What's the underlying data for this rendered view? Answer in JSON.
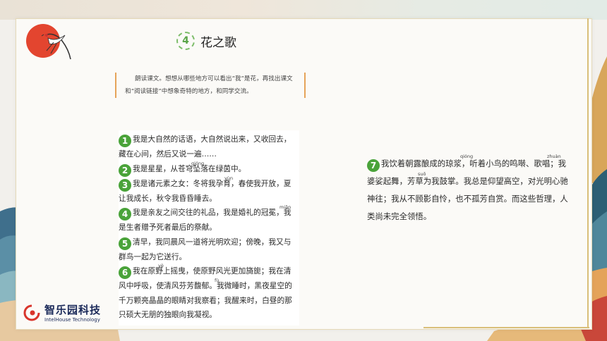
{
  "lesson": {
    "number": "4",
    "title": "花之歌"
  },
  "instruction": "朗读课文。想想从哪些地方可以看出“我”是花，再找出课文和“阅读链接”中想象奇特的地方，和同学交流。",
  "stanzas": [
    {
      "num": "1",
      "text": "我是大自然的话语，大自然说出来，又收回去，藏在心间，然后又说一遍……"
    },
    {
      "num": "2",
      "text": "我是星星，从苍穹坠落在绿茵中。",
      "pinyin": [
        {
          "char": "穹",
          "py": "qióng"
        }
      ]
    },
    {
      "num": "3",
      "text": "我是诸元素之女：冬将我孕育，春使我开放，夏让我成长，秋令我昏昏睡去。",
      "pinyin": [
        {
          "char": "孕",
          "py": "yùn"
        }
      ]
    },
    {
      "num": "4",
      "text": "我是亲友之间交往的礼品，我是婚礼的冠冕，我是生者赠予死者最后的祭献。",
      "pinyin": [
        {
          "char": "冕",
          "py": "miǎn"
        }
      ]
    },
    {
      "num": "5",
      "text": "清早，我同晨风一道将光明欢迎；傍晚，我又与群鸟一起为它送行。"
    },
    {
      "num": "6",
      "text": "我在原野上摇曳，使原野风光更加旖旎；我在清风中呼吸，使清风芬芳馥郁。我微睡时，黑夜星空的千万颗亮晶晶的眼睛对我察看；我醒来时，白昼的那只硕大无朋的独眼向我凝视。",
      "pinyin": [
        {
          "char": "曳",
          "py": "yè"
        },
        {
          "char": "馥",
          "py": "fù"
        }
      ]
    }
  ],
  "stanza7": {
    "num": "7",
    "text": "我饮着朝露酿成的琼浆，听着小鸟的鸣啭、歌唱；我婆娑起舞，芳草为我鼓掌。我总是仰望高空，对光明心驰神往；我从不顾影自怜，也不孤芳自赏。而这些哲理，人类尚未完全领悟。",
    "pinyin": [
      {
        "char": "琼",
        "py": "qióng"
      },
      {
        "char": "啭",
        "py": "zhuàn"
      },
      {
        "char": "娑",
        "py": "suō"
      }
    ]
  },
  "logo": {
    "cn": "智乐园科技",
    "en": "IntelHouse Technology"
  },
  "colors": {
    "accent_green": "#4aa33a",
    "accent_red": "#e3452f",
    "gold": "#d9bf7a",
    "orange_border": "#e6a45a"
  },
  "icons": [
    "red-sun-icon",
    "crane-icon",
    "logo-mark-icon"
  ]
}
